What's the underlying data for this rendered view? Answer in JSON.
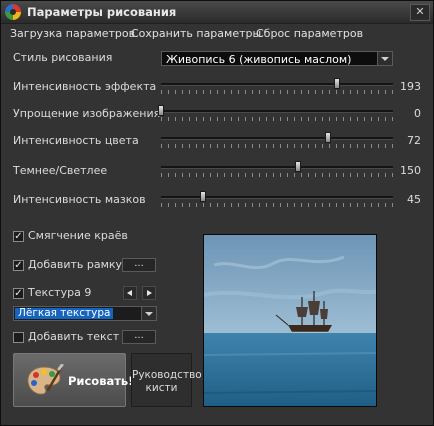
{
  "window": {
    "title": "Параметры рисования",
    "close": "✕"
  },
  "menu": [
    "Загрузка параметров",
    "Сохранить параметры",
    "Сброс параметров"
  ],
  "style": {
    "label": "Стиль рисования",
    "value": "Живопись 6 (живопись маслом)"
  },
  "sliders": [
    {
      "label": "Интенсивность эффекта",
      "value": "193",
      "level": 0.76
    },
    {
      "label": "Упрощение изображения",
      "value": "0",
      "level": 0.0
    },
    {
      "label": "Интенсивность цвета",
      "value": "72",
      "level": 0.72
    },
    {
      "label": "Темнее/Светлее",
      "value": "150",
      "level": 0.59
    },
    {
      "label": "Интенсивность мазков",
      "value": "45",
      "level": 0.18
    }
  ],
  "options": {
    "smoothing": {
      "label": "Смягчение краёв",
      "checked": true
    },
    "frame": {
      "label": "Добавить рамку",
      "checked": true,
      "button": "..."
    },
    "texture": {
      "label": "Текстура 9",
      "checked": true,
      "select": "Лёгкая текстура"
    },
    "text": {
      "label": "Добавить текст",
      "checked": false,
      "button": "..."
    }
  },
  "buttons": {
    "draw": "Рисовать!",
    "guide_line1": "Руководство",
    "guide_line2": "кисти"
  },
  "colors": {
    "accent_select": "#1565c0",
    "background": "#333333",
    "sea": "#2f6b8e",
    "sky": "#6a93b3"
  },
  "icons": {
    "draw": "palette-icon",
    "app": "app-logo-icon",
    "ship": "sailing-ship-icon"
  }
}
